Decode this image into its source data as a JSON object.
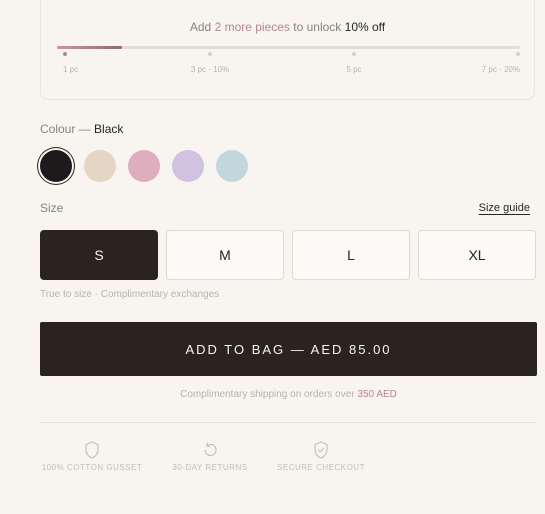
{
  "promo": {
    "text_pre": "Add ",
    "text_highlight": "2 more pieces",
    "text_mid": " to unlock ",
    "text_strong": "10% off",
    "progress_fraction": 0.14,
    "tiers": [
      {
        "label": "1 pc",
        "active": true
      },
      {
        "label": "3 pc · 10%",
        "active": false
      },
      {
        "label": "5 pc",
        "active": false
      },
      {
        "label": "7 pc · 20%",
        "active": false
      }
    ]
  },
  "colour": {
    "label": "Colour — ",
    "selected": "Black",
    "swatches": [
      {
        "name": "Black",
        "hex": "#1c1a1a",
        "selected": true
      },
      {
        "name": "Nude",
        "hex": "#e4d5c5",
        "selected": false
      },
      {
        "name": "Rose",
        "hex": "#deaebe",
        "selected": false
      },
      {
        "name": "Lilac",
        "hex": "#d0c2e0",
        "selected": false
      },
      {
        "name": "Sky",
        "hex": "#c3d7de",
        "selected": false
      }
    ]
  },
  "size": {
    "label": "Size",
    "guide_label": "Size guide",
    "options": [
      {
        "label": "S",
        "selected": true
      },
      {
        "label": "M",
        "selected": false
      },
      {
        "label": "L",
        "selected": false
      },
      {
        "label": "XL",
        "selected": false
      }
    ],
    "note": "True to size · Complimentary exchanges"
  },
  "cta": {
    "label": "ADD TO BAG — AED 85.00"
  },
  "shipping": {
    "text": "Complimentary shipping on orders over ",
    "highlight": "350 AED"
  },
  "features": [
    {
      "icon": "shield-icon",
      "label": "100% COTTON GUSSET"
    },
    {
      "icon": "return-arrow-icon",
      "label": "30-DAY RETURNS"
    },
    {
      "icon": "shield-check-icon",
      "label": "SECURE CHECKOUT"
    }
  ],
  "colors": {
    "accent": "#b3868d",
    "dark": "#2a2320",
    "background": "#f8f5f0"
  }
}
